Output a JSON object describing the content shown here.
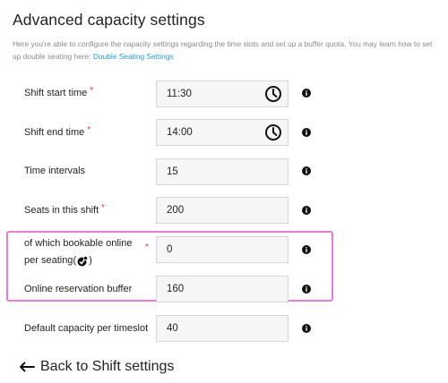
{
  "page": {
    "title": "Advanced capacity settings",
    "intro_text": "Here you're able to configure the capacity settings regarding the time slots and set up a buffer quota. You may learn how to set up double seating here:",
    "intro_link": "Double Seating Settings"
  },
  "fields": {
    "shift_start": {
      "label": "Shift start time",
      "required_mark": "*",
      "value": "11:30",
      "icon": "clock-icon"
    },
    "shift_end": {
      "label": "Shift end time",
      "required_mark": "*",
      "value": "14:00",
      "icon": "clock-icon"
    },
    "time_intervals": {
      "label": "Time intervals",
      "value": "15"
    },
    "seats": {
      "label": "Seats in this shift",
      "required_mark": "*",
      "value": "200"
    },
    "bookable_online": {
      "label_line1": "of which bookable online",
      "label_line2_before": "per seating",
      "label_bracket_open": "(",
      "label_bracket_close": ")",
      "required_mark": "*",
      "value": "0",
      "icon": "double-seating-icon"
    },
    "online_buffer": {
      "label": "Online reservation buffer",
      "value": "160"
    },
    "default_capacity": {
      "label": "Default capacity per timeslot",
      "value": "40"
    }
  },
  "navigation": {
    "back_label": "Back to Shift settings"
  },
  "colors": {
    "highlight": "#e87ad9",
    "required": "#e53935",
    "link": "#2a9fd8"
  }
}
